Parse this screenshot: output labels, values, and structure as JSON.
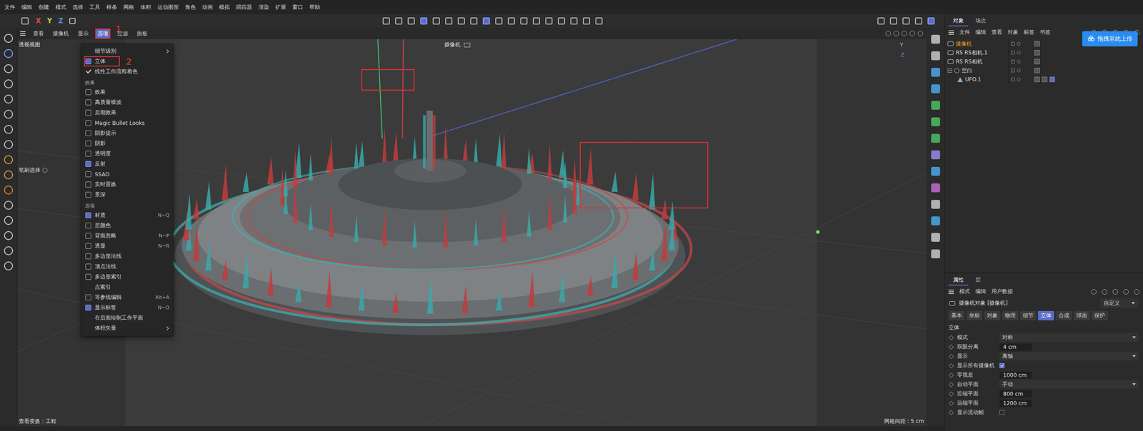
{
  "menubar": [
    "文件",
    "编辑",
    "创建",
    "模式",
    "选择",
    "工具",
    "样条",
    "网格",
    "体积",
    "运动图形",
    "角色",
    "动画",
    "模拟",
    "跟踪器",
    "渲染",
    "扩展",
    "窗口",
    "帮助"
  ],
  "toolbar": {
    "axes": [
      {
        "label": "X",
        "color": "#e04848"
      },
      {
        "label": "Y",
        "color": "#b8d04a"
      },
      {
        "label": "Z",
        "color": "#5b8de0"
      }
    ]
  },
  "viewport": {
    "header": [
      {
        "label": "查看",
        "selected": false
      },
      {
        "label": "摄像机",
        "selected": false
      },
      {
        "label": "显示",
        "selected": false
      },
      {
        "label": "选项",
        "selected": true,
        "annotation": "1"
      },
      {
        "label": "过滤",
        "selected": false
      },
      {
        "label": "面板",
        "selected": false
      }
    ],
    "title": "透视视图",
    "camera_label": "摄像机",
    "side_label": "笔刷选择",
    "view_transform": "查看变换 : 工程",
    "grid_spacing": "网格间距 : 5 cm",
    "axis_labels": [
      "Y",
      "Z"
    ]
  },
  "options_menu": [
    {
      "kind": "submenu",
      "label": "细节级别"
    },
    {
      "kind": "icon",
      "label": "立体",
      "active": true,
      "annotation": "2"
    },
    {
      "kind": "check",
      "label": "线性工作流程着色",
      "checked": true
    },
    {
      "kind": "section",
      "label": "效果"
    },
    {
      "kind": "icon",
      "label": "效果",
      "active": false
    },
    {
      "kind": "icon",
      "label": "高质量噪波",
      "active": false
    },
    {
      "kind": "icon",
      "label": "后期效果",
      "active": false
    },
    {
      "kind": "icon",
      "label": "Magic Bullet Looks",
      "active": false
    },
    {
      "kind": "icon",
      "label": "阴影提示",
      "active": false
    },
    {
      "kind": "icon",
      "label": "阴影",
      "active": false
    },
    {
      "kind": "icon",
      "label": "透明度",
      "active": false
    },
    {
      "kind": "icon",
      "label": "反射",
      "active": true
    },
    {
      "kind": "icon",
      "label": "SSAO",
      "active": false
    },
    {
      "kind": "icon",
      "label": "实时置换",
      "active": false
    },
    {
      "kind": "icon",
      "label": "景深",
      "active": false
    },
    {
      "kind": "section",
      "label": "选项"
    },
    {
      "kind": "icon",
      "label": "材质",
      "active": true,
      "shortcut": "N~Q"
    },
    {
      "kind": "icon",
      "label": "层颜色",
      "active": false
    },
    {
      "kind": "icon",
      "label": "背面忽略",
      "active": false,
      "shortcut": "N~P"
    },
    {
      "kind": "icon",
      "label": "透显",
      "active": false,
      "shortcut": "N~R"
    },
    {
      "kind": "icon",
      "label": "多边形法线",
      "active": false
    },
    {
      "kind": "icon",
      "label": "顶点法线",
      "active": false
    },
    {
      "kind": "icon",
      "label": "多边形索引",
      "active": false
    },
    {
      "kind": "plain",
      "label": "点索引"
    },
    {
      "kind": "icon",
      "label": "等参线编辑",
      "active": false,
      "shortcut": "Alt+A"
    },
    {
      "kind": "icon",
      "label": "显示标签",
      "active": true,
      "shortcut": "N~O"
    },
    {
      "kind": "plain",
      "label": "在后面绘制工作平面"
    },
    {
      "kind": "submenu",
      "label": "体积矢量"
    }
  ],
  "object_manager": {
    "tabs": [
      {
        "label": "对象",
        "selected": true
      },
      {
        "label": "场次",
        "selected": false
      }
    ],
    "menu": [
      "文件",
      "编辑",
      "查看",
      "对象",
      "标签",
      "书签"
    ],
    "upload_button": "拖拽至此上传",
    "objects": [
      {
        "name": "摄像机",
        "depth": 0,
        "selected": true,
        "kind": "camera"
      },
      {
        "name": "RS RS相机.1",
        "depth": 0,
        "selected": false,
        "kind": "camera"
      },
      {
        "name": "RS RS相机",
        "depth": 0,
        "selected": false,
        "kind": "camera"
      },
      {
        "name": "空白",
        "depth": 0,
        "selected": false,
        "kind": "null",
        "expanded": true
      },
      {
        "name": "UFO.1",
        "depth": 1,
        "selected": false,
        "kind": "mesh"
      }
    ]
  },
  "attributes": {
    "tabs": [
      {
        "label": "属性",
        "selected": true
      },
      {
        "label": "层",
        "selected": false
      }
    ],
    "menu": [
      "模式",
      "编辑",
      "用户数据"
    ],
    "object_title": "摄像机对象 [摄像机]",
    "preset": "自定义",
    "sections": [
      {
        "label": "基本",
        "selected": false
      },
      {
        "label": "坐标",
        "selected": false
      },
      {
        "label": "对象",
        "selected": false
      },
      {
        "label": "物理",
        "selected": false
      },
      {
        "label": "细节",
        "selected": false
      },
      {
        "label": "立体",
        "selected": true
      },
      {
        "label": "合成",
        "selected": false
      },
      {
        "label": "球面",
        "selected": false
      },
      {
        "label": "保护",
        "selected": false
      }
    ],
    "heading": "立体",
    "fields": [
      {
        "kind": "dropdown",
        "label": "模式",
        "value": "对称"
      },
      {
        "kind": "number",
        "label": "双眼分离",
        "value": "4 cm"
      },
      {
        "kind": "dropdown",
        "label": "显示",
        "value": "离轴"
      },
      {
        "kind": "checkbox",
        "label": "显示所有摄像机",
        "checked": true
      },
      {
        "kind": "number",
        "label": "零视差",
        "value": "1000 cm"
      },
      {
        "kind": "dropdown",
        "label": "自动平面",
        "value": "手动"
      },
      {
        "kind": "number",
        "label": "近端平面",
        "value": "800 cm"
      },
      {
        "kind": "number",
        "label": "远端平面",
        "value": "1200 cm"
      },
      {
        "kind": "checkbox",
        "label": "显示流动帧",
        "checked": false
      }
    ]
  }
}
